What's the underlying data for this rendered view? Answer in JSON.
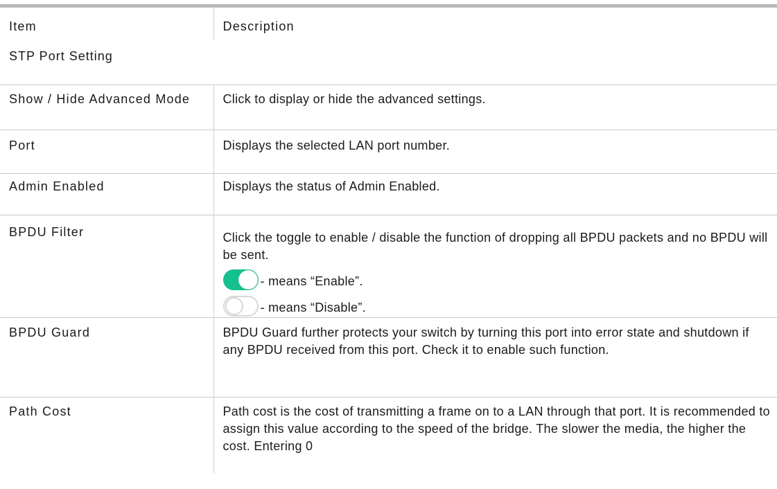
{
  "table": {
    "header": {
      "item": "Item",
      "description": "Description"
    },
    "section_title": "STP Port Setting",
    "rows": [
      {
        "item": "Show / Hide Advanced Mode",
        "description": "Click to display or hide the advanced settings."
      },
      {
        "item": "Port",
        "description": "Displays the selected LAN port number."
      },
      {
        "item": "Admin Enabled",
        "description": "Displays the status of Admin Enabled."
      },
      {
        "item": "BPDU Filter",
        "description": "Click the toggle to enable / disable the function of dropping all BPDU packets and no BPDU will be sent.",
        "toggle_on_caption": "- means “Enable”.",
        "toggle_off_caption": "- means “Disable”."
      },
      {
        "item": "BPDU Guard",
        "description": "BPDU Guard further protects your switch by turning this port into error state and shutdown if any BPDU received from this port. Check it to enable such function."
      },
      {
        "item": "Path Cost",
        "description": "Path cost is the cost of transmitting a frame on to a LAN through that port. It is recommended to assign this value according to the speed of the bridge. The slower the media, the higher the cost. Entering 0"
      }
    ]
  },
  "colors": {
    "toggle_on": "#14c08f",
    "toggle_off_border": "#d8d8d8",
    "rule": "#b8b8b8"
  }
}
